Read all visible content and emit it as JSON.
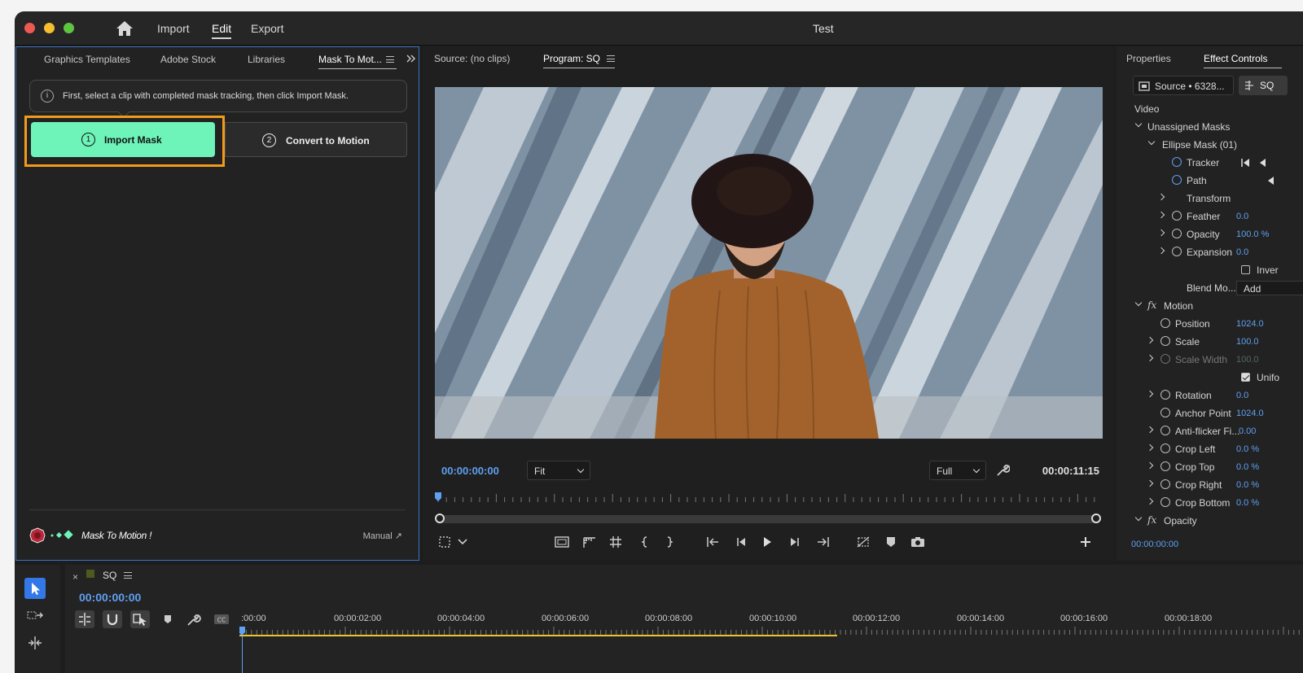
{
  "window": {
    "title": "Test",
    "workspace_tabs": [
      "Import",
      "Edit",
      "Export"
    ],
    "active_workspace": "Edit"
  },
  "left_panel": {
    "tabs": [
      "Graphics Templates",
      "Adobe Stock",
      "Libraries",
      "Mask To Mot..."
    ],
    "hint": "First, select a clip with completed mask tracking, then click Import Mask.",
    "hint_icon": "i",
    "step1": {
      "num": "1",
      "label": "Import Mask"
    },
    "step2": {
      "num": "2",
      "label": "Convert to Motion"
    },
    "brand": "Mask To Motion !",
    "manual": "Manual ↗"
  },
  "program": {
    "tabs": [
      "Source: (no clips)",
      "Program: SQ"
    ],
    "timecode_current": "00:00:00:00",
    "timecode_duration": "00:00:11:15",
    "zoom": "Fit",
    "resolution": "Full"
  },
  "effects": {
    "tabs": [
      "Properties",
      "Effect Controls"
    ],
    "source": "Source • 6328...",
    "sequence": "SQ",
    "rows": [
      {
        "label": "Video"
      },
      {
        "label": "Unassigned Masks"
      },
      {
        "label": "Ellipse Mask (01)"
      },
      {
        "label": "Tracker"
      },
      {
        "label": "Path"
      },
      {
        "label": "Transform"
      },
      {
        "label": "Feather",
        "value": "0.0"
      },
      {
        "label": "Opacity",
        "value": "100.0 %"
      },
      {
        "label": "Expansion",
        "value": "0.0"
      },
      {
        "label": "Inver"
      },
      {
        "label": "Blend Mo...",
        "value": "Add"
      },
      {
        "label": "Motion"
      },
      {
        "label": "Position",
        "value": "1024.0"
      },
      {
        "label": "Scale",
        "value": "100.0"
      },
      {
        "label": "Scale Width",
        "value": "100.0"
      },
      {
        "label": "Unifo"
      },
      {
        "label": "Rotation",
        "value": "0.0"
      },
      {
        "label": "Anchor Point",
        "value": "1024.0"
      },
      {
        "label": "Anti-flicker Fi...",
        "value": "0.00"
      },
      {
        "label": "Crop Left",
        "value": "0.0 %"
      },
      {
        "label": "Crop Top",
        "value": "0.0 %"
      },
      {
        "label": "Crop Right",
        "value": "0.0 %"
      },
      {
        "label": "Crop Bottom",
        "value": "0.0 %"
      },
      {
        "label": "Opacity"
      }
    ],
    "timecode": "00:00:00:00"
  },
  "timeline": {
    "sequence": "SQ",
    "close": "×",
    "timecode": "00:00:00:00",
    "ticks": [
      ":00:00",
      "00:00:02:00",
      "00:00:04:00",
      "00:00:06:00",
      "00:00:08:00",
      "00:00:10:00",
      "00:00:12:00",
      "00:00:14:00",
      "00:00:16:00",
      "00:00:18:00"
    ]
  },
  "colors": {
    "accent_blue": "#5fa0f0",
    "import_button": "#6ef3b9",
    "highlight_orange": "#f29b1a"
  }
}
